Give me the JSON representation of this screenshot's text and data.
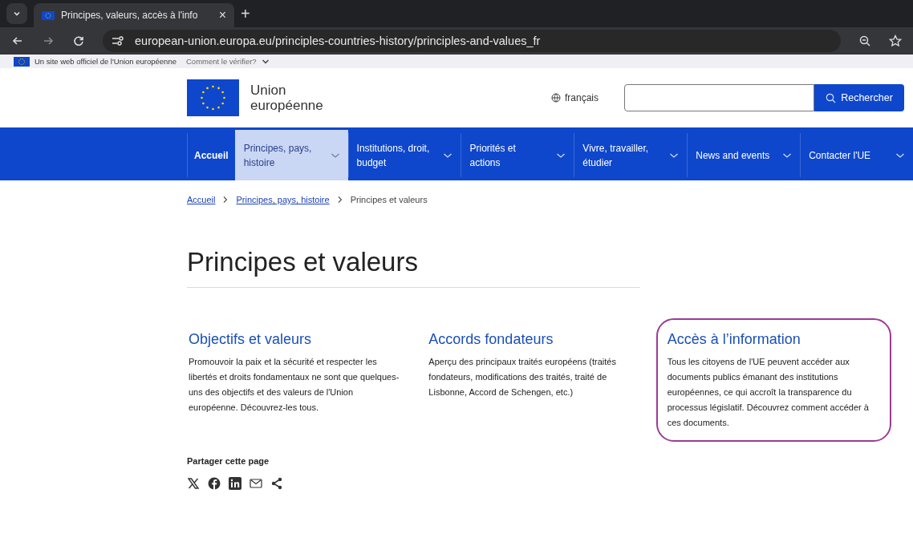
{
  "browser": {
    "tab": {
      "title": "Principes, valeurs, accès à l'info",
      "close": "×"
    },
    "new_tab": "+",
    "url": "european-union.europa.eu/principles-countries-history/principles-and-values_fr"
  },
  "official_bar": {
    "text": "Un site web officiel de l'Union européenne",
    "link": "Comment le vérifier?"
  },
  "header": {
    "logo_line_1": "Union",
    "logo_line_2": "européenne",
    "language": "français",
    "search": {
      "button": "Rechercher"
    }
  },
  "nav": [
    {
      "label": "Accueil",
      "dropdown": false,
      "selected": false
    },
    {
      "label": "Principes, pays, histoire",
      "dropdown": true,
      "selected": true
    },
    {
      "label": "Institutions, droit, budget",
      "dropdown": true,
      "selected": false
    },
    {
      "label": "Priorités et actions",
      "dropdown": true,
      "selected": false
    },
    {
      "label": "Vivre, travailler, étudier",
      "dropdown": true,
      "selected": false
    },
    {
      "label": "News and events",
      "dropdown": true,
      "selected": false
    },
    {
      "label": "Contacter l'UE",
      "dropdown": true,
      "selected": false
    }
  ],
  "breadcrumb": [
    "Accueil",
    "Principes, pays, histoire",
    "Principes et valeurs"
  ],
  "title": "Principes et valeurs",
  "cards": [
    {
      "title": "Objectifs et valeurs",
      "text": "Promouvoir la paix et la sécurité et respecter les libertés et droits fondamentaux ne sont que quelques-uns des objectifs et des valeurs de l'Union européenne. Découvrez-les tous.",
      "highlighted": false
    },
    {
      "title": "Accords fondateurs",
      "text": "Aperçu des principaux traités européens (traités fondateurs, modifications des traités, traité de Lisbonne, Accord de Schengen, etc.)",
      "highlighted": false
    },
    {
      "title": "Accès à l’information",
      "text": "Tous les citoyens de l'UE peuvent accéder aux documents publics émanant des institutions européennes, ce qui accroît la transparence du processus législatif. Découvrez comment accéder à ces documents.",
      "highlighted": true
    }
  ],
  "share": {
    "label": "Partager cette page",
    "icons": [
      {
        "kind": "x"
      },
      {
        "kind": "facebook"
      },
      {
        "kind": "linkedin"
      },
      {
        "kind": "email"
      },
      {
        "kind": "share"
      }
    ]
  }
}
